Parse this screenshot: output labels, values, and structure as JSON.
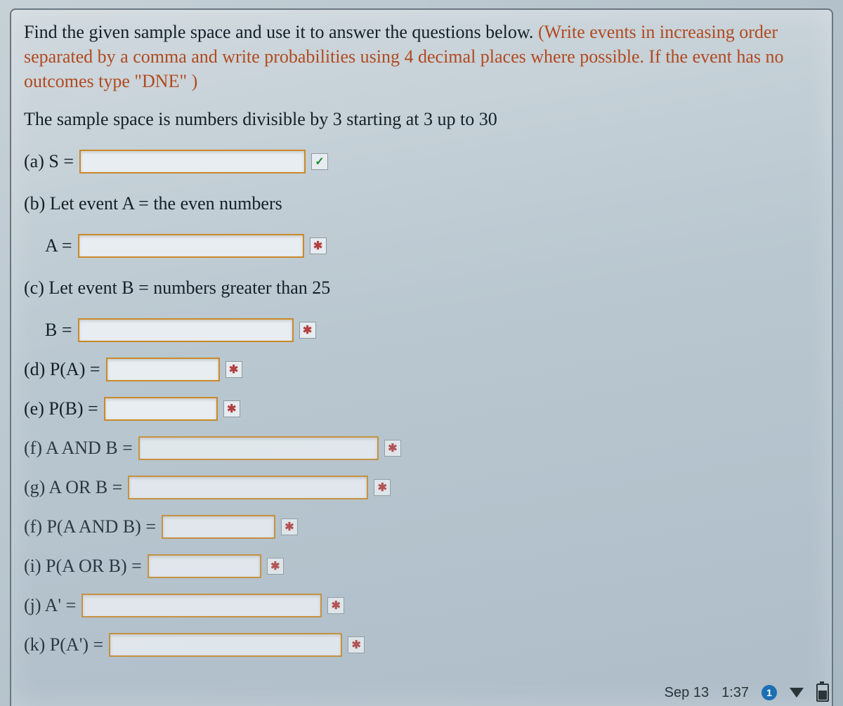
{
  "intro": {
    "main": "Find the given sample space and use it to answer the questions below. ",
    "hint": "(Write events in increasing order separated by a comma and write probabilities using 4 decimal places where possible. If the event has no outcomes type \"DNE\" )"
  },
  "desc": "The sample space is numbers divisible by 3 starting at 3 up to 30",
  "q": {
    "a": {
      "label": "(a) S =",
      "mark": "ok"
    },
    "b_text": "(b) Let event A = the even numbers",
    "b": {
      "label": "A =",
      "mark": "bad"
    },
    "c_text": "(c) Let event B = numbers greater than 25",
    "c": {
      "label": "B =",
      "mark": "bad"
    },
    "d": {
      "label": "(d) P(A) =",
      "mark": "bad"
    },
    "e": {
      "label": "(e) P(B) =",
      "mark": "bad"
    },
    "f": {
      "label": "(f) A AND B =",
      "mark": "bad"
    },
    "g": {
      "label": "(g) A OR B =",
      "mark": "bad"
    },
    "h": {
      "label": "(f) P(A AND B) =",
      "mark": "bad"
    },
    "i": {
      "label": "(i) P(A OR B) =",
      "mark": "bad"
    },
    "j": {
      "label": "(j) A' =",
      "mark": "bad"
    },
    "k": {
      "label": "(k) P(A') =",
      "mark": "bad"
    }
  },
  "marks": {
    "ok": "✓",
    "bad": "✱"
  },
  "status": {
    "date": "Sep 13",
    "time": "1:37",
    "badge": "1"
  }
}
